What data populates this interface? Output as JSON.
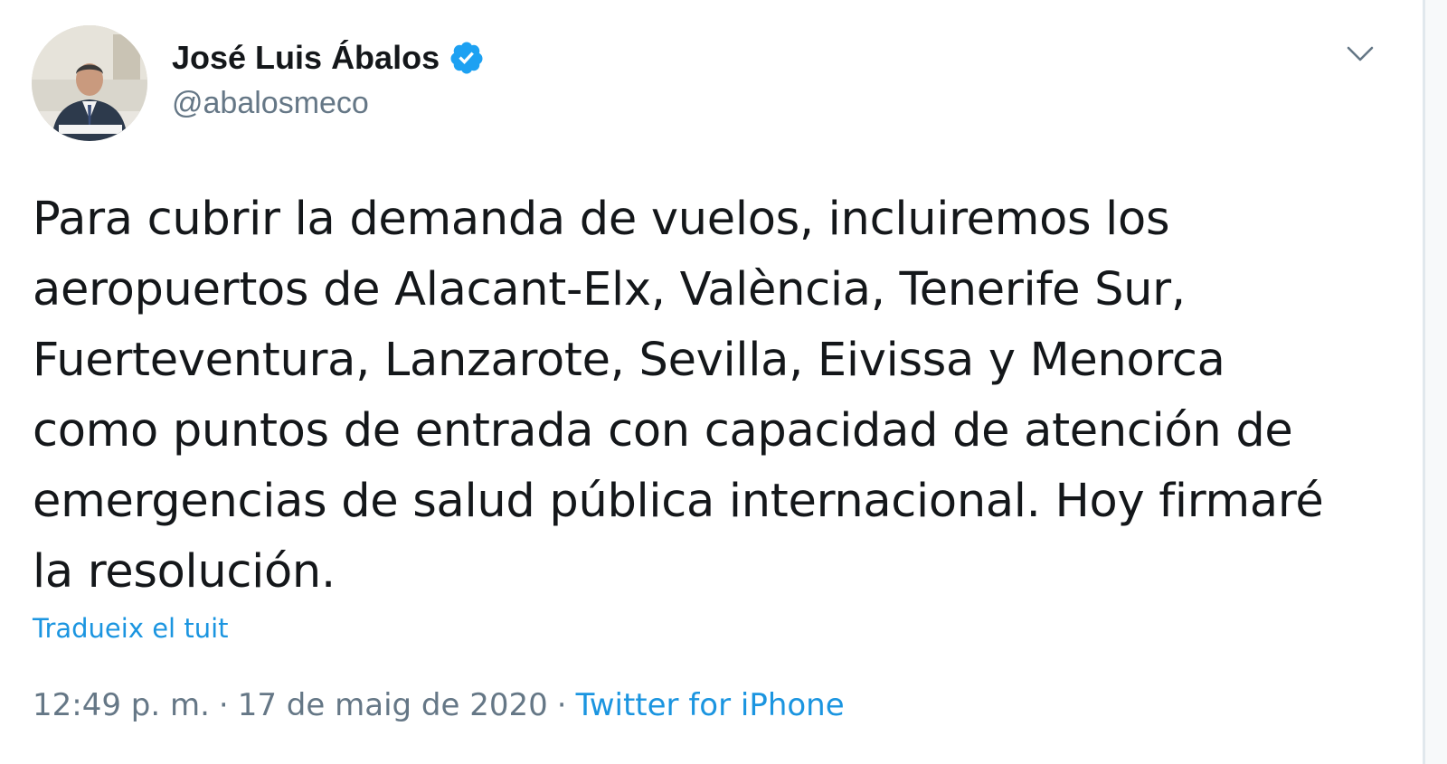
{
  "author": {
    "display_name": "José Luis Ábalos",
    "handle": "@abalosmeco",
    "verified": true,
    "avatar_icon": "profile-photo"
  },
  "tweet": {
    "text": "Para cubrir la demanda de vuelos, incluiremos los\naeropuertos de Alacant-Elx, València, Tenerife Sur,\nFuerteventura, Lanzarote, Sevilla, Eivissa y Menorca\ncomo puntos de entrada con capacidad de atención de\nemergencias de salud pública internacional. Hoy firmaré\nla resolución.",
    "translate_label": "Tradueix el tuit",
    "time": "12:49 p. m.",
    "separator": "·",
    "date": "17 de maig de 2020",
    "source": "Twitter for iPhone"
  },
  "colors": {
    "link": "#1b95e0",
    "verified": "#1da1f2",
    "muted": "#657786",
    "text": "#14171a"
  },
  "icons": {
    "verified": "verified-badge-icon",
    "menu": "chevron-down-icon"
  }
}
